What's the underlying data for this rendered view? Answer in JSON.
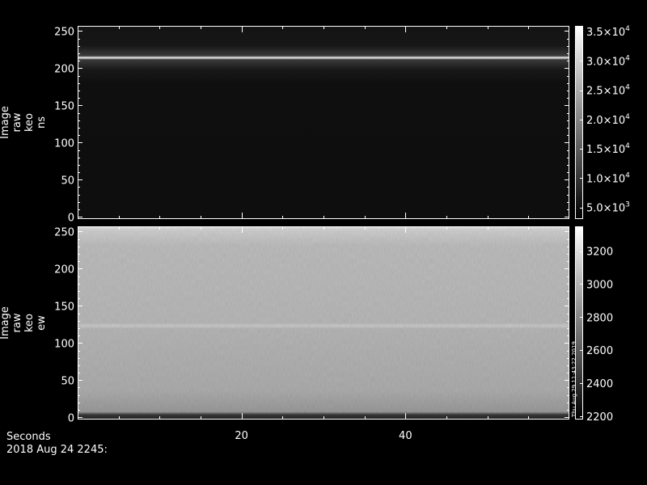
{
  "footer": {
    "x_axis_label": "Seconds",
    "date_label": "2018 Aug 24 2245:"
  },
  "side_stamp": "Thu Aug 29 11:43:22 2019",
  "chart_data": [
    {
      "type": "heatmap",
      "ylabel_lines": [
        "Image",
        "raw",
        "keo",
        "ns"
      ],
      "xlim": [
        0,
        60
      ],
      "ylim": [
        -3,
        257
      ],
      "x_ticks": [
        20,
        40
      ],
      "x_tick_labels": [
        "20",
        "40"
      ],
      "y_ticks": [
        0,
        50,
        100,
        150,
        200,
        250
      ],
      "y_tick_labels": [
        "0",
        "50",
        "100",
        "150",
        "200",
        "250"
      ],
      "colorbar": {
        "range": [
          3000,
          36000
        ],
        "ticks": [
          5000,
          10000,
          15000,
          20000,
          25000,
          30000,
          35000
        ],
        "tick_labels": [
          {
            "mant": "5.0",
            "exp": "3"
          },
          {
            "mant": "1.0",
            "exp": "4"
          },
          {
            "mant": "1.5",
            "exp": "4"
          },
          {
            "mant": "2.0",
            "exp": "4"
          },
          {
            "mant": "2.5",
            "exp": "4"
          },
          {
            "mant": "3.0",
            "exp": "4"
          },
          {
            "mant": "3.5",
            "exp": "4"
          }
        ]
      },
      "features": {
        "background_level": 4200,
        "bright_band_row": 210,
        "bright_band_level": 34000
      }
    },
    {
      "type": "heatmap",
      "ylabel_lines": [
        "Image",
        "raw",
        "keo",
        "ew"
      ],
      "xlim": [
        0,
        60
      ],
      "ylim": [
        -3,
        257
      ],
      "x_ticks": [
        20,
        40
      ],
      "x_tick_labels": [
        "20",
        "40"
      ],
      "y_ticks": [
        0,
        50,
        100,
        150,
        200,
        250
      ],
      "y_tick_labels": [
        "0",
        "50",
        "100",
        "150",
        "200",
        "250"
      ],
      "colorbar": {
        "range": [
          2180,
          3350
        ],
        "ticks": [
          2200,
          2400,
          2600,
          2800,
          3000,
          3200
        ],
        "tick_labels": [
          {
            "mant": "2200",
            "exp": ""
          },
          {
            "mant": "2400",
            "exp": ""
          },
          {
            "mant": "2600",
            "exp": ""
          },
          {
            "mant": "2800",
            "exp": ""
          },
          {
            "mant": "3000",
            "exp": ""
          },
          {
            "mant": "3200",
            "exp": ""
          }
        ]
      },
      "features": {
        "background_level": 2950,
        "faint_line_row": 120,
        "dark_bottom_row": 0
      }
    }
  ]
}
